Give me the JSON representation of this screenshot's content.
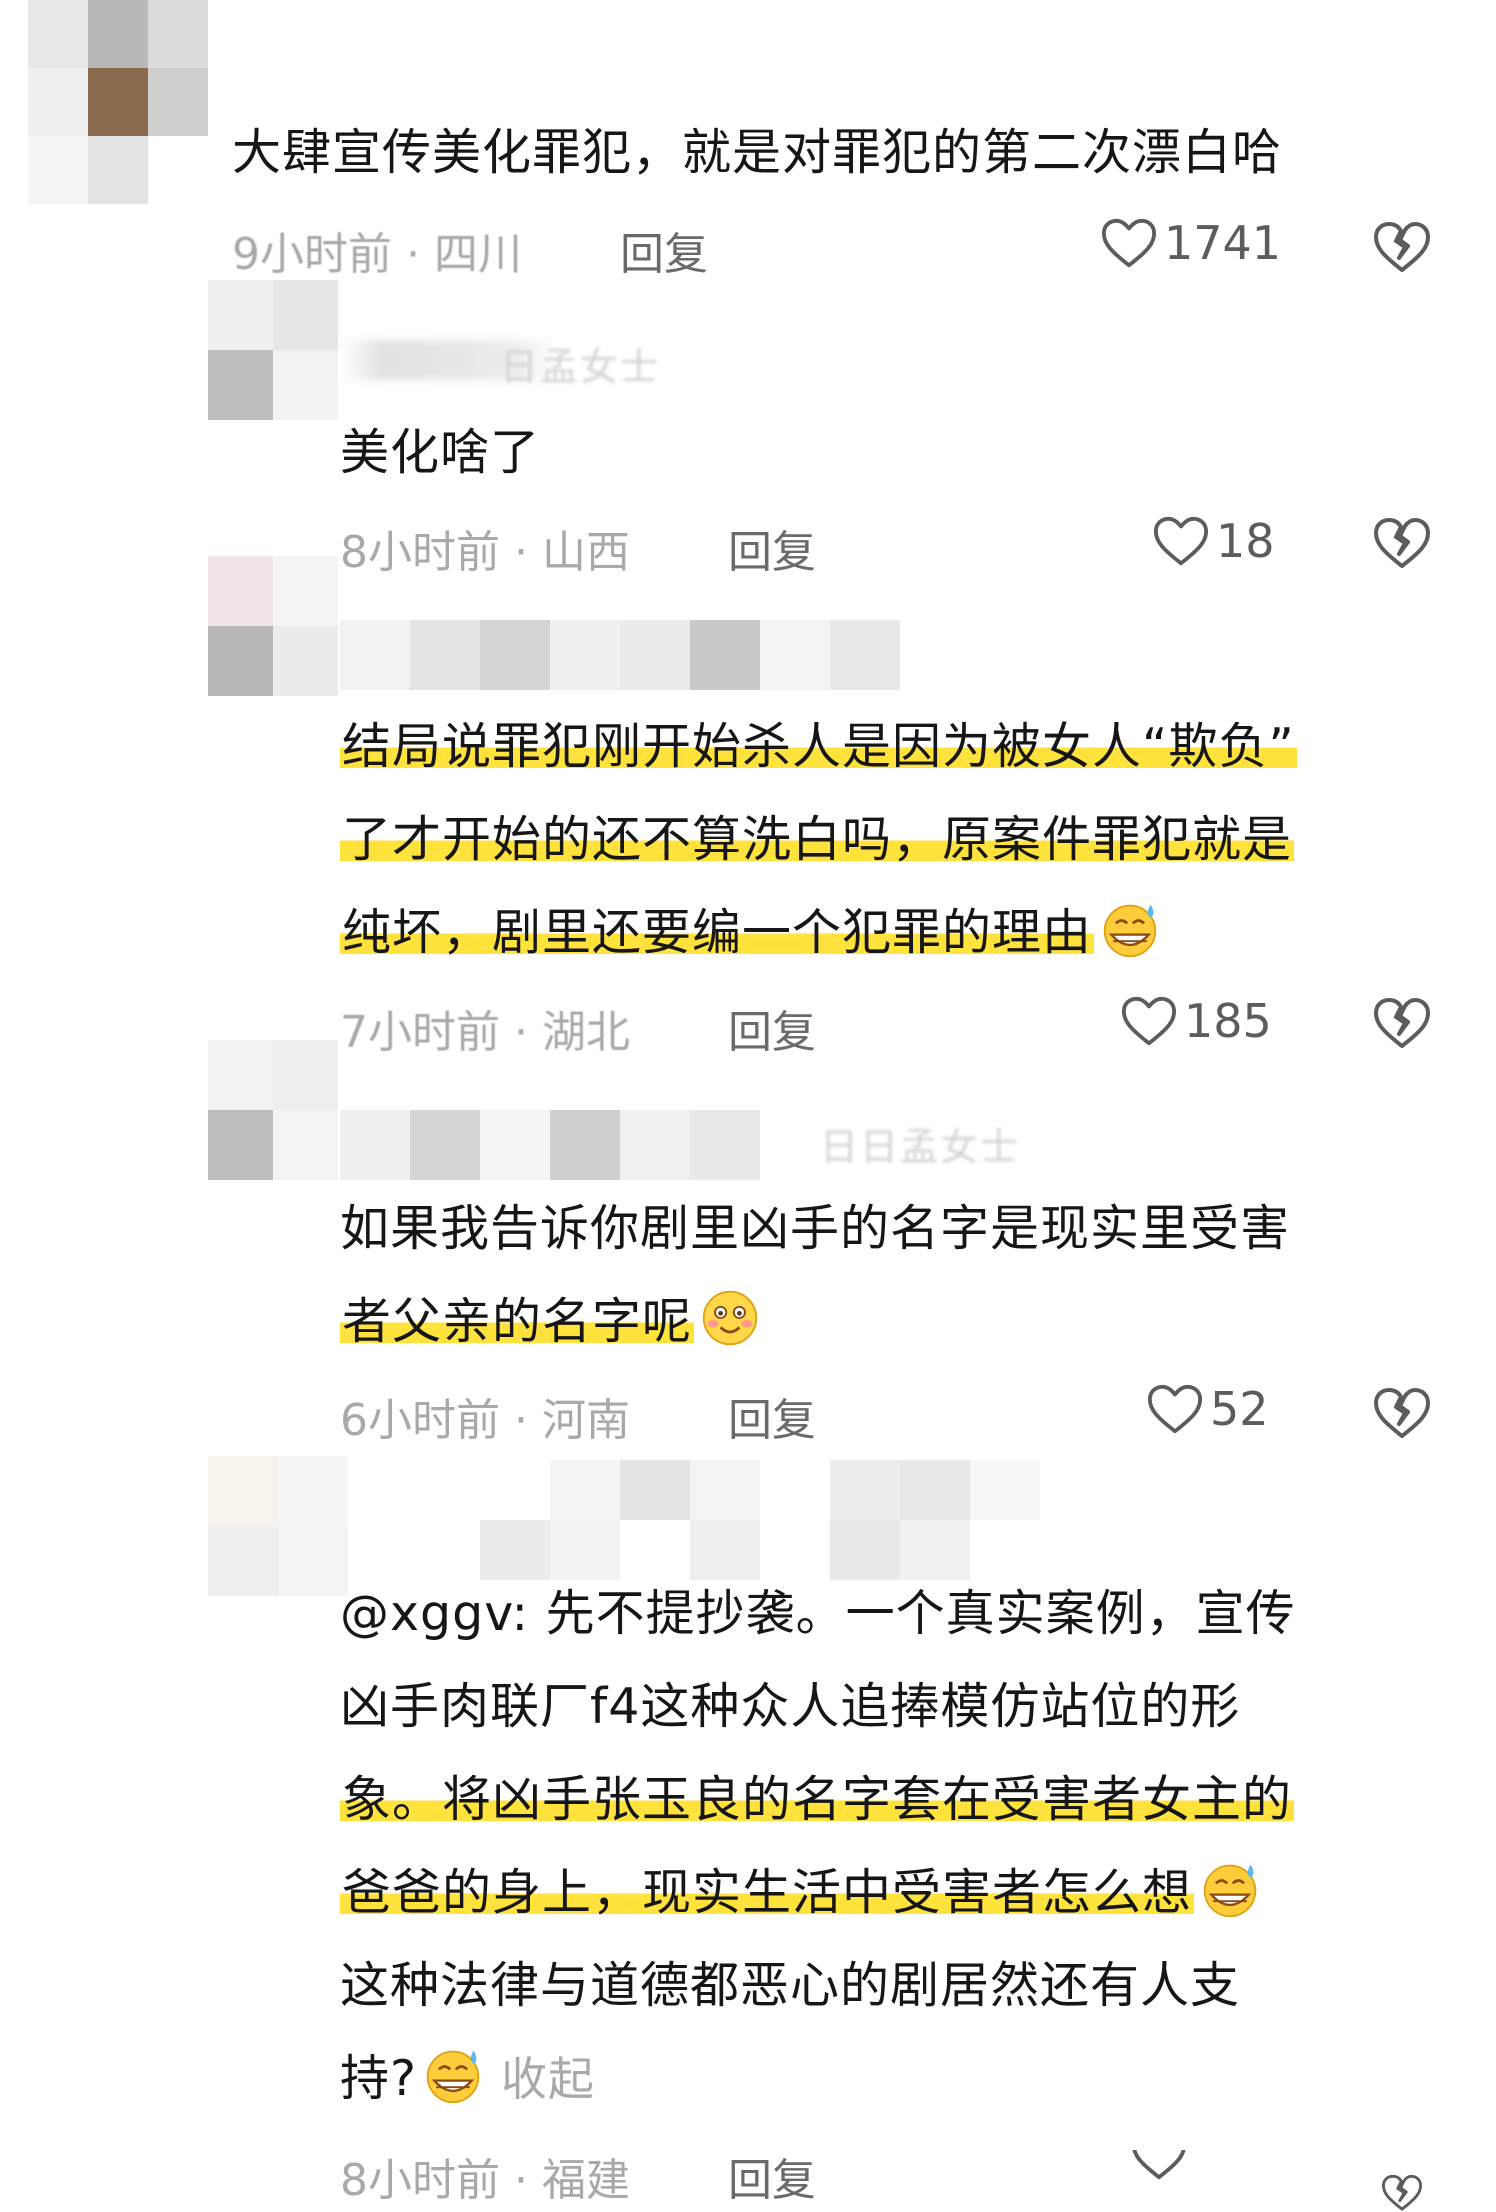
{
  "comments": [
    {
      "text_lines": [
        "大肆宣传美化罪犯，就是对罪犯的第二次漂白哈"
      ],
      "time": "9小时前",
      "location": "四川",
      "reply_label": "回复",
      "likes": "1741"
    },
    {
      "reply_to_name": "日孟女士",
      "text_lines": [
        "美化啥了"
      ],
      "time": "8小时前",
      "location": "山西",
      "reply_label": "回复",
      "likes": "18"
    },
    {
      "text_lines": [
        "结局说罪犯刚开始杀人是因为被女人“欺负”",
        "了才开始的还不算洗白吗，原案件罪犯就是",
        "纯坏，剧里还要编一个犯罪的理由"
      ],
      "time": "7小时前",
      "location": "湖北",
      "reply_label": "回复",
      "likes": "185"
    },
    {
      "reply_to_name": "日日孟女士",
      "text_lines": [
        "如果我告诉你剧里凶手的名字是现实里受害",
        "者父亲的名字呢"
      ],
      "time": "6小时前",
      "location": "河南",
      "reply_label": "回复",
      "likes": "52"
    },
    {
      "text_lines": [
        "@xggv: 先不提抄袭。一个真实案例，宣传",
        "凶手肉联厂f4这种众人追捧模仿站位的形",
        "象。将凶手张玉良的名字套在受害者女主的",
        "爸爸的身上，现实生活中受害者怎么想",
        "这种法律与道德都恶心的剧居然还有人支",
        "持?"
      ],
      "collapse_label": "收起",
      "time": "8小时前",
      "location": "福建",
      "reply_label": "回复"
    }
  ],
  "meta_separator": " · ",
  "icons": {
    "like": "heart-outline-icon",
    "dislike": "broken-heart-icon",
    "emoji_sweat": "grinning-sweat-emoji",
    "emoji_blush": "smiling-blush-emoji"
  },
  "colors": {
    "highlight": "#ffe23b",
    "text": "#161616",
    "meta": "#a9a9a9",
    "icon": "#5c5c5c"
  }
}
